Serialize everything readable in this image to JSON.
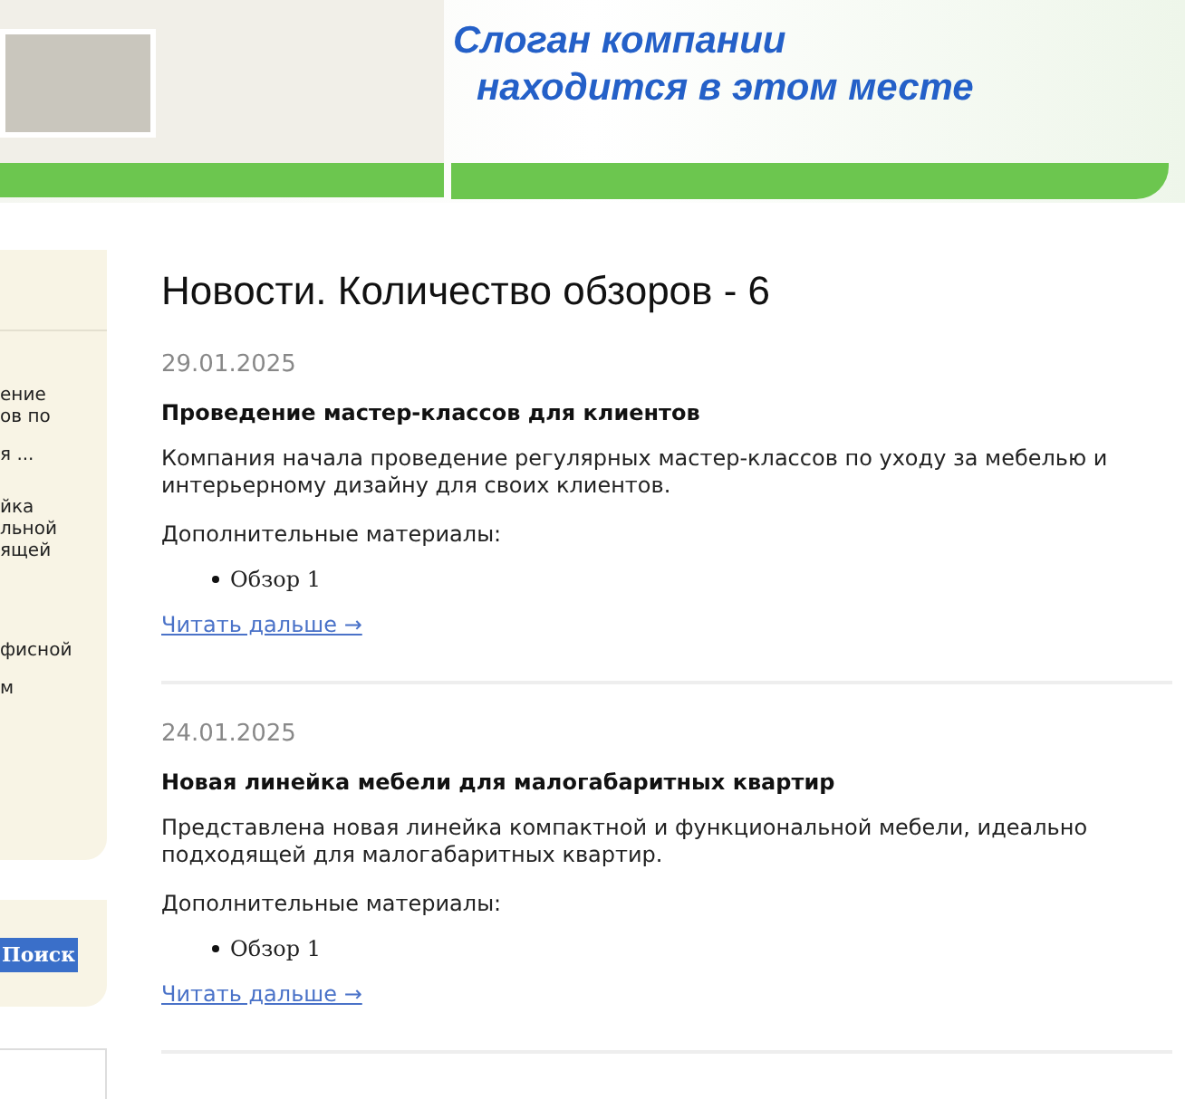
{
  "header": {
    "slogan": [
      "Слоган компании",
      "находится в этом месте"
    ]
  },
  "sidebar": {
    "news_items": [
      {
        "lines": [
          "ение",
          "ов по"
        ]
      },
      {
        "lines": [
          "я ..."
        ]
      },
      {
        "lines": [
          "йка",
          "льной",
          "ящей"
        ]
      },
      {
        "lines": [
          "фисной"
        ]
      },
      {
        "lines": [
          "м"
        ]
      }
    ],
    "search_button": "Поиск"
  },
  "main": {
    "title": "Новости. Количество обзоров - 6",
    "news": [
      {
        "date": "29.01.2025",
        "headline": "Проведение мастер-классов для клиентов",
        "text": "Компания начала проведение регулярных мастер-классов по уходу за мебелью и интерьерному дизайну для своих клиентов.",
        "materials_label": "Дополнительные материалы:",
        "materials": [
          "Обзор 1"
        ],
        "more": "Читать дальше →"
      },
      {
        "date": "24.01.2025",
        "headline": "Новая линейка мебели для малогабаритных квартир",
        "text": "Представлена новая линейка компактной и функциональной мебели, идеально подходящей для малогабаритных квартир.",
        "materials_label": "Дополнительные материалы:",
        "materials": [
          "Обзор 1"
        ],
        "more": "Читать дальше →"
      }
    ]
  }
}
